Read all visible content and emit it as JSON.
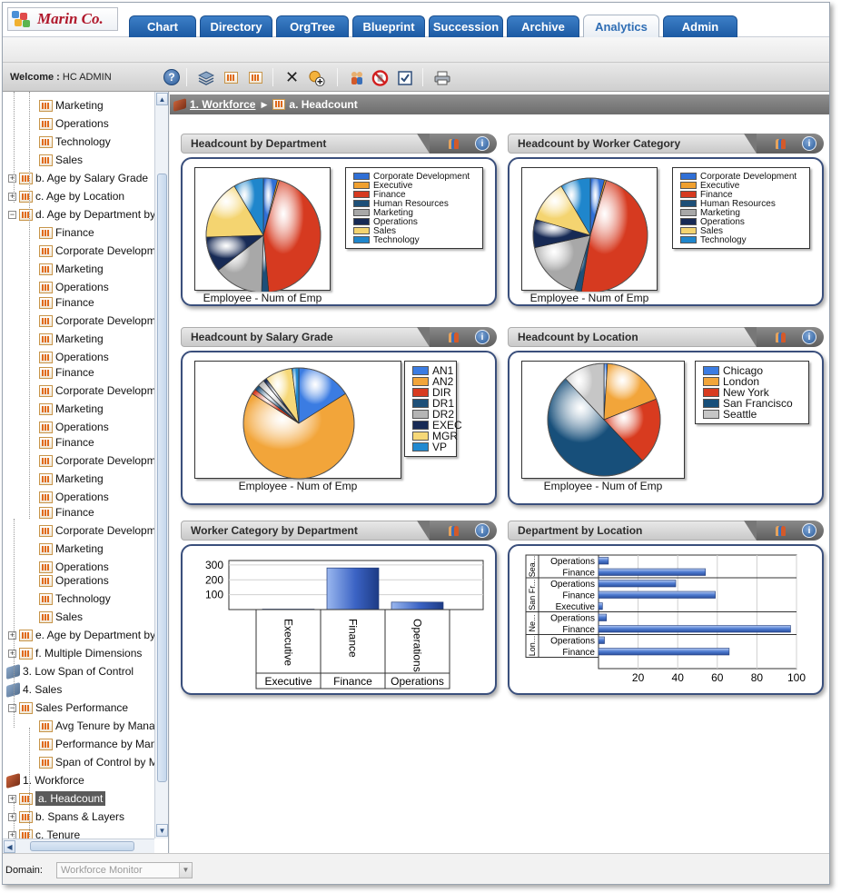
{
  "app": {
    "logo_text": "Marin Co."
  },
  "nav_tabs": [
    {
      "label": "Chart"
    },
    {
      "label": "Directory"
    },
    {
      "label": "OrgTree"
    },
    {
      "label": "Blueprint"
    },
    {
      "label": "Succession"
    },
    {
      "label": "Archive"
    },
    {
      "label": "Analytics",
      "active": true
    },
    {
      "label": "Admin"
    }
  ],
  "toolbar": {
    "welcome_label": "Welcome :",
    "user": "HC ADMIN"
  },
  "breadcrumb": {
    "parent": "1. Workforce",
    "current": "a. Headcount"
  },
  "tree": [
    {
      "label": "Marketing",
      "icon": "report",
      "indent": 2
    },
    {
      "label": "Operations",
      "icon": "report",
      "indent": 2
    },
    {
      "label": "Technology",
      "icon": "report",
      "indent": 2
    },
    {
      "label": "Sales",
      "icon": "report",
      "indent": 2
    },
    {
      "label": "b. Age by Salary Grade",
      "icon": "report",
      "indent": 1,
      "expander": "+"
    },
    {
      "label": "c. Age by Location",
      "icon": "report",
      "indent": 1,
      "expander": "+"
    },
    {
      "label": "d. Age by Department by Salary Grade",
      "icon": "report",
      "indent": 1,
      "expander": "-"
    },
    {
      "label": "Finance",
      "icon": "report",
      "indent": 2
    },
    {
      "label": "Corporate Development",
      "icon": "report",
      "indent": 2
    },
    {
      "label": "Marketing",
      "icon": "report",
      "indent": 2
    },
    {
      "label": "Operations",
      "icon": "report",
      "indent": 2
    },
    {
      "label": "Finance",
      "icon": "report",
      "indent": 2
    },
    {
      "label": "Corporate Development",
      "icon": "report",
      "indent": 2
    },
    {
      "label": "Marketing",
      "icon": "report",
      "indent": 2
    },
    {
      "label": "Operations",
      "icon": "report",
      "indent": 2
    },
    {
      "label": "Finance",
      "icon": "report",
      "indent": 2
    },
    {
      "label": "Corporate Development",
      "icon": "report",
      "indent": 2
    },
    {
      "label": "Marketing",
      "icon": "report",
      "indent": 2
    },
    {
      "label": "Operations",
      "icon": "report",
      "indent": 2
    },
    {
      "label": "Finance",
      "icon": "report",
      "indent": 2
    },
    {
      "label": "Corporate Development",
      "icon": "report",
      "indent": 2
    },
    {
      "label": "Marketing",
      "icon": "report",
      "indent": 2
    },
    {
      "label": "Operations",
      "icon": "report",
      "indent": 2
    },
    {
      "label": "Finance",
      "icon": "report",
      "indent": 2
    },
    {
      "label": "Corporate Development",
      "icon": "report",
      "indent": 2
    },
    {
      "label": "Marketing",
      "icon": "report",
      "indent": 2
    },
    {
      "label": "Operations",
      "icon": "report",
      "indent": 2
    },
    {
      "label": "Operations",
      "icon": "report",
      "indent": 2
    },
    {
      "label": "Technology",
      "icon": "report",
      "indent": 2
    },
    {
      "label": "Sales",
      "icon": "report",
      "indent": 2
    },
    {
      "label": "e. Age by Department by Location",
      "icon": "report",
      "indent": 1,
      "expander": "+"
    },
    {
      "label": "f. Multiple Dimensions",
      "icon": "report",
      "indent": 1,
      "expander": "+"
    },
    {
      "label": "3. Low Span of Control",
      "icon": "folder",
      "indent": 0
    },
    {
      "label": "4. Sales",
      "icon": "folder",
      "indent": 0
    },
    {
      "label": "Sales Performance",
      "icon": "report",
      "indent": 1,
      "expander": "-"
    },
    {
      "label": "Avg Tenure by Manager",
      "icon": "report",
      "indent": 2
    },
    {
      "label": "Performance by Manager",
      "icon": "report",
      "indent": 2
    },
    {
      "label": "Span of Control by Manager",
      "icon": "report",
      "indent": 2
    },
    {
      "label": "1. Workforce",
      "icon": "book",
      "indent": 0
    },
    {
      "label": "a. Headcount",
      "icon": "report",
      "indent": 1,
      "expander": "+",
      "selected": true
    },
    {
      "label": "b. Spans & Layers",
      "icon": "report",
      "indent": 1,
      "expander": "+"
    },
    {
      "label": "c. Tenure",
      "icon": "report",
      "indent": 1,
      "expander": "+"
    }
  ],
  "panels": {
    "dept": {
      "title": "Headcount by Department",
      "caption": "Employee - Num of Emp"
    },
    "worker": {
      "title": "Headcount by Worker Category",
      "caption": "Employee - Num of Emp"
    },
    "salary": {
      "title": "Headcount by Salary Grade",
      "caption": "Employee - Num of Emp"
    },
    "location": {
      "title": "Headcount by Location",
      "caption": "Employee - Num of Emp"
    },
    "wcdept": {
      "title": "Worker Category by Department"
    },
    "deptloc": {
      "title": "Department by Location"
    }
  },
  "chart_data": [
    {
      "id": "dept",
      "type": "pie",
      "title": "Headcount by Department",
      "xlabel": "Employee - Num of Emp",
      "categories": [
        "Corporate Development",
        "Executive",
        "Finance",
        "Human Resources",
        "Marketing",
        "Operations",
        "Sales",
        "Technology"
      ],
      "values": [
        4,
        0.5,
        44,
        2,
        14,
        10,
        17,
        8.5
      ],
      "colors": [
        "#2f6fd6",
        "#f0a030",
        "#d63a20",
        "#1d4f78",
        "#a8a8a8",
        "#172a55",
        "#f4d470",
        "#1f86cc"
      ],
      "legend": "right"
    },
    {
      "id": "worker",
      "type": "pie",
      "title": "Headcount by Worker Category",
      "xlabel": "Employee - Num of Emp",
      "categories": [
        "Corporate Development",
        "Executive",
        "Finance",
        "Human Resources",
        "Marketing",
        "Operations",
        "Sales",
        "Technology"
      ],
      "values": [
        4,
        0.5,
        48,
        2,
        17,
        8,
        12,
        8.5
      ],
      "colors": [
        "#2f6fd6",
        "#f0a030",
        "#d63a20",
        "#1d4f78",
        "#a8a8a8",
        "#172a55",
        "#f4d470",
        "#1f86cc"
      ],
      "legend": "right"
    },
    {
      "id": "salary",
      "type": "pie",
      "title": "Headcount by Salary Grade",
      "xlabel": "Employee - Num of Emp",
      "categories": [
        "AN1",
        "AN2",
        "DIR",
        "DR1",
        "DR2",
        "EXEC",
        "MGR",
        "VP"
      ],
      "values": [
        16,
        68,
        1.5,
        1.5,
        2,
        1,
        8,
        2
      ],
      "colors": [
        "#3b7ce2",
        "#f2a53a",
        "#d83b1f",
        "#1d4f78",
        "#b5b5b5",
        "#172a55",
        "#f6d878",
        "#2189d0"
      ],
      "legend": "right"
    },
    {
      "id": "location",
      "type": "pie",
      "title": "Headcount by Location",
      "xlabel": "Employee - Num of Emp",
      "categories": [
        "Chicago",
        "London",
        "New York",
        "San Francisco",
        "Seattle"
      ],
      "values": [
        1,
        18,
        19,
        50,
        12
      ],
      "colors": [
        "#3b7ce2",
        "#f2a53a",
        "#d83b1f",
        "#174f7a",
        "#c6c6c6"
      ],
      "legend": "right"
    },
    {
      "id": "wcdept",
      "type": "bar",
      "title": "Worker Category by Department",
      "categories": [
        "Executive",
        "Finance",
        "Operations"
      ],
      "values": [
        3,
        280,
        50
      ],
      "yticks": [
        100,
        200,
        300
      ],
      "ylim": [
        0,
        330
      ],
      "color": "#3b63c4"
    },
    {
      "id": "deptloc",
      "type": "bar",
      "orientation": "horizontal",
      "title": "Department by Location",
      "groups": [
        {
          "label": "Sea...",
          "rows": [
            {
              "label": "Operations",
              "value": 5
            },
            {
              "label": "Finance",
              "value": 54
            }
          ]
        },
        {
          "label": "San Fr...",
          "rows": [
            {
              "label": "Operations",
              "value": 39
            },
            {
              "label": "Finance",
              "value": 59
            },
            {
              "label": "Executive",
              "value": 2
            }
          ]
        },
        {
          "label": "Ne...",
          "rows": [
            {
              "label": "Operations",
              "value": 4
            },
            {
              "label": "Finance",
              "value": 97
            }
          ]
        },
        {
          "label": "Lon...",
          "rows": [
            {
              "label": "Operations",
              "value": 3
            },
            {
              "label": "Finance",
              "value": 66
            }
          ]
        }
      ],
      "xticks": [
        20,
        40,
        60,
        80,
        100
      ],
      "xlim": [
        0,
        100
      ],
      "color": "#4d7ad0"
    }
  ],
  "status_bar": {
    "domain_label": "Domain:",
    "domain_value": "Workforce Monitor"
  }
}
